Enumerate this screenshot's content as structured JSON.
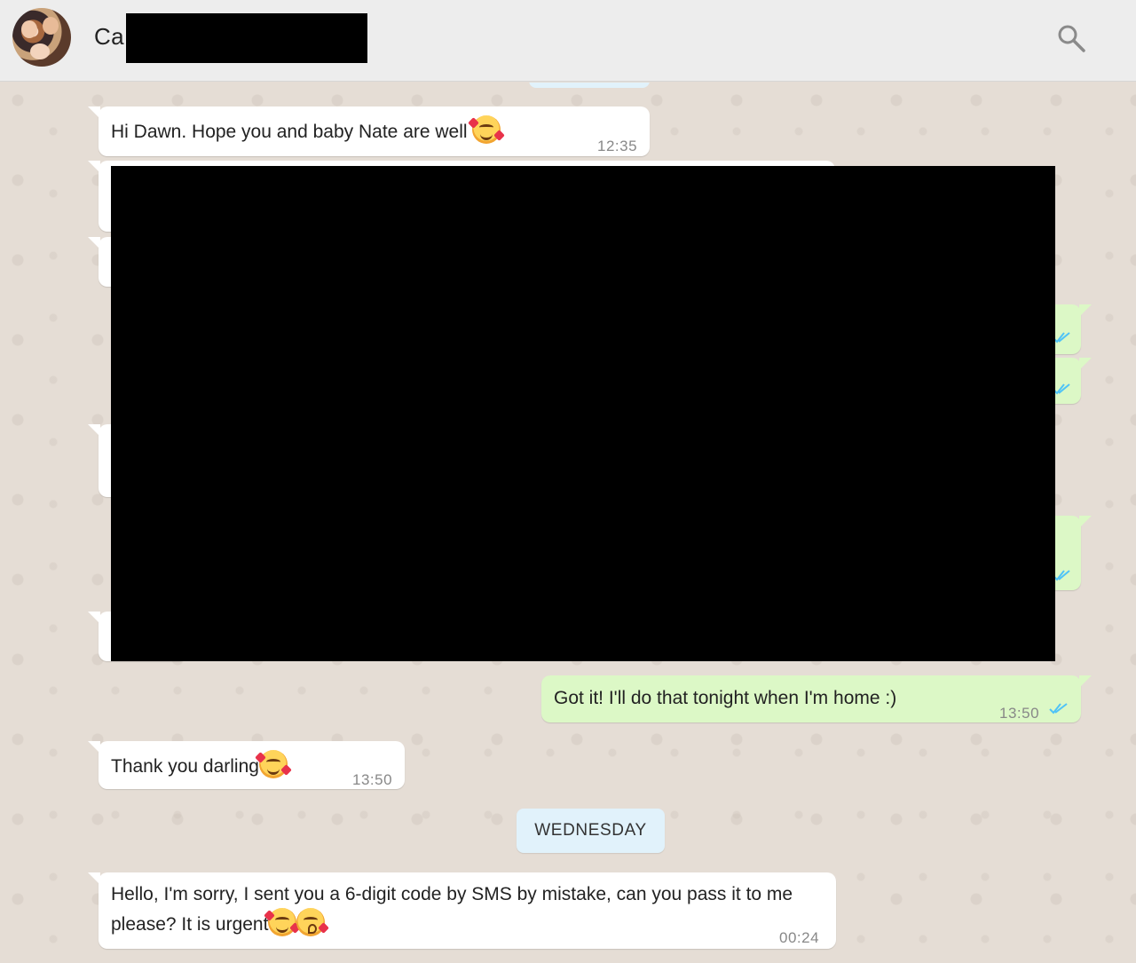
{
  "header": {
    "contact_name": "Ca",
    "search_icon": "search-icon"
  },
  "messages": [
    {
      "direction": "in",
      "text": "Hi Dawn. Hope you and baby Nate are well",
      "emoji": [
        "smiling-face-with-hearts"
      ],
      "time": "12:35"
    },
    {
      "direction": "out",
      "text": "Got it! I'll do that tonight when I'm home :)",
      "time": "13:50",
      "status": "read"
    },
    {
      "direction": "in",
      "text": "Thank you darling",
      "emoji": [
        "smiling-face-with-hearts"
      ],
      "time": "13:50"
    },
    {
      "direction": "in",
      "text": "Hello, I'm sorry, I sent you a 6-digit code by SMS by mistake, can you pass it to me please? It is urgent",
      "emoji": [
        "smiling-face-with-hearts",
        "face-blowing-a-kiss"
      ],
      "time": "00:24"
    }
  ],
  "date_separator": "WEDNESDAY",
  "colors": {
    "header_bg": "#ededed",
    "chat_bg": "#e5ddd5",
    "incoming_bubble": "#ffffff",
    "outgoing_bubble": "#dcf8c6",
    "read_tick": "#4fc3f7",
    "date_chip": "#e1f2fb"
  }
}
